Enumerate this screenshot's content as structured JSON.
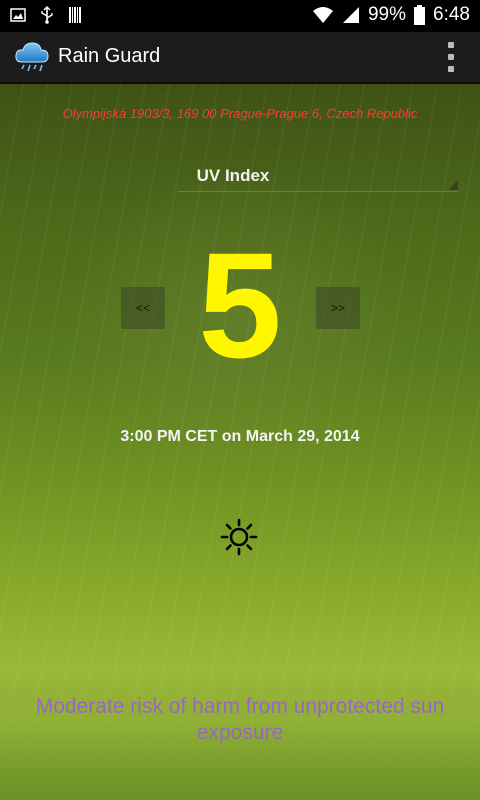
{
  "status_bar": {
    "battery": "99%",
    "time": "6:48",
    "icons": [
      "image-icon",
      "usb-icon",
      "barcode-icon",
      "wifi-icon",
      "signal-icon",
      "battery-icon"
    ]
  },
  "action_bar": {
    "app_icon": "cloud-rain-icon",
    "title": "Rain Guard",
    "overflow_icon": "overflow-menu-icon"
  },
  "main": {
    "address": "Olympijská 1903/3, 169 00 Prague-Prague 6, Czech Republic",
    "metric_spinner": {
      "selected": "UV Index"
    },
    "prev_label": "<<",
    "next_label": ">>",
    "uv_value": "5",
    "timestamp": "3:00 PM CET on March 29, 2014",
    "condition_icon": "sun-icon",
    "risk_text": "Moderate risk of harm from unprotected sun exposure"
  },
  "colors": {
    "address": "#ff3b2f",
    "uv_value": "#fff600",
    "risk_text": "#9a66c2"
  }
}
